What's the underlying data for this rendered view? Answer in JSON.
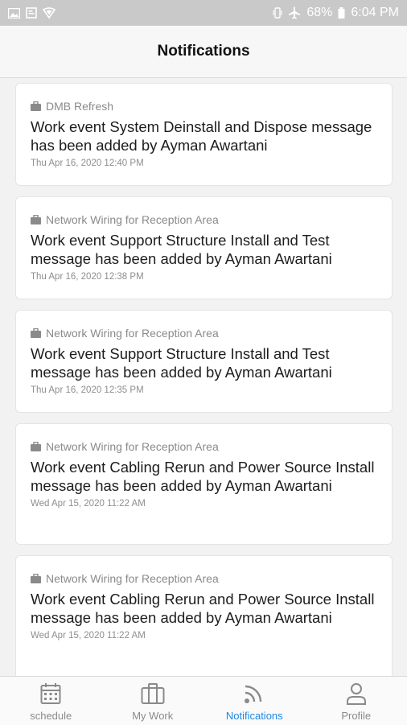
{
  "status_bar": {
    "battery": "68%",
    "time": "6:04 PM"
  },
  "header": {
    "title": "Notifications"
  },
  "notifications": [
    {
      "project": "DMB Refresh",
      "message": "Work event System Deinstall and Dispose message has been added by Ayman Awartani",
      "time": "Thu Apr 16, 2020 12:40 PM"
    },
    {
      "project": "Network Wiring for Reception Area",
      "message": "Work event Support Structure Install and Test message has been added by Ayman Awartani",
      "time": "Thu Apr 16, 2020 12:38 PM"
    },
    {
      "project": "Network Wiring for Reception Area",
      "message": "Work event Support Structure Install and Test message has been added by Ayman Awartani",
      "time": "Thu Apr 16, 2020 12:35 PM"
    },
    {
      "project": "Network Wiring for Reception Area",
      "message": "Work event Cabling Rerun and Power Source Install message has been added by Ayman Awartani",
      "time": "Wed Apr 15, 2020 11:22 AM"
    },
    {
      "project": "Network Wiring for Reception Area",
      "message": "Work event Cabling Rerun and Power Source Install message has been added by Ayman Awartani",
      "time": "Wed Apr 15, 2020 11:22 AM"
    }
  ],
  "tabs": [
    {
      "label": "schedule",
      "icon": "calendar-icon",
      "active": false
    },
    {
      "label": "My Work",
      "icon": "briefcase-icon",
      "active": false
    },
    {
      "label": "Notifications",
      "icon": "feed-icon",
      "active": true
    },
    {
      "label": "Profile",
      "icon": "person-icon",
      "active": false
    }
  ],
  "colors": {
    "accent": "#1e88e5",
    "status_bar": "#c9c9c9",
    "background": "#f2f2f2"
  }
}
